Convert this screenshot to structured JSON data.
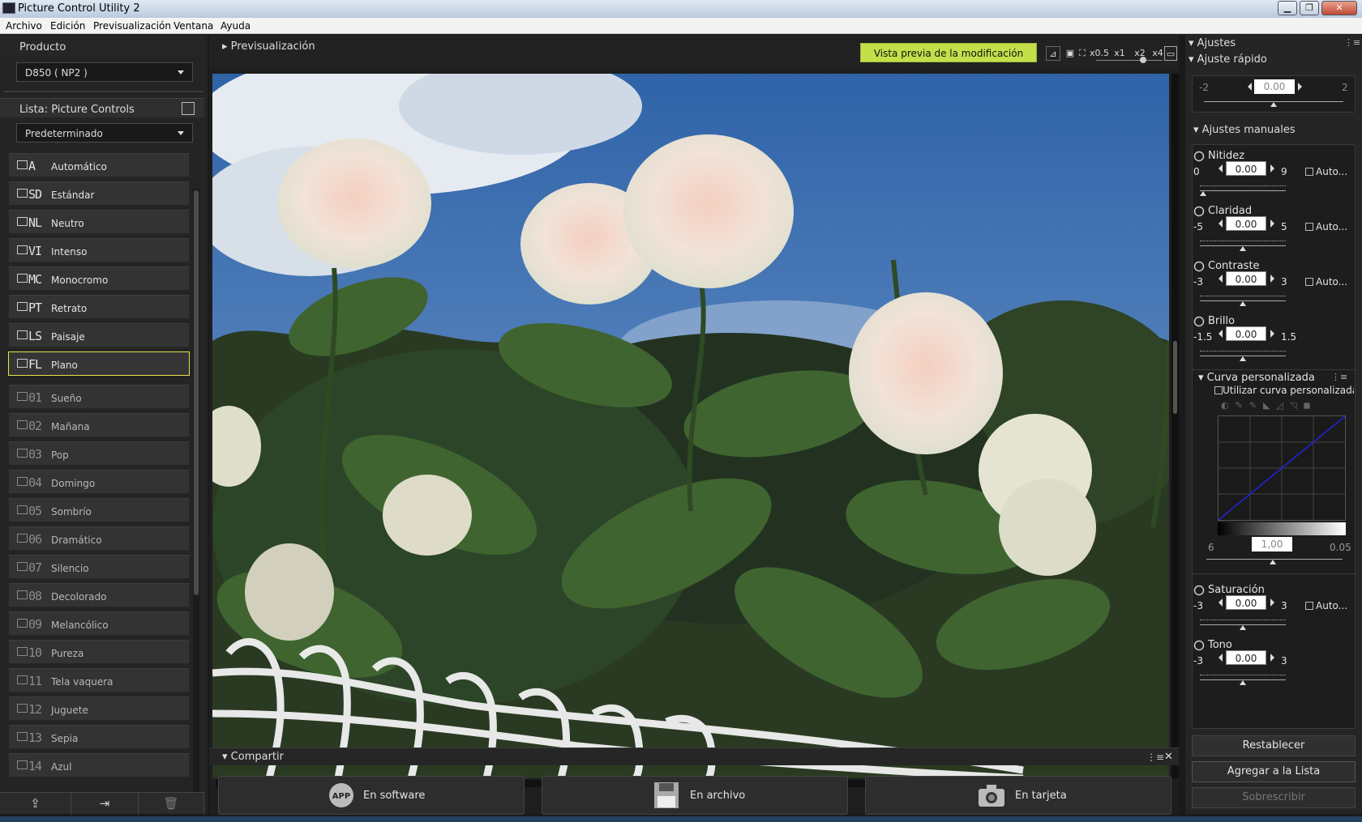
{
  "window": {
    "title": "Picture Control Utility 2",
    "minimize": "▁",
    "maximize": "❐",
    "close": "✕"
  },
  "menu": [
    "Archivo",
    "Edición",
    "Previsualización",
    "Ventana",
    "Ayuda"
  ],
  "left": {
    "product_header": "Producto",
    "product_value": "D850 ( NP2 )",
    "list_header": "Lista: Picture Controls",
    "list_filter": "Predeterminado",
    "presets": [
      {
        "code": "A",
        "name": "Automático"
      },
      {
        "code": "SD",
        "name": "Estándar"
      },
      {
        "code": "NL",
        "name": "Neutro"
      },
      {
        "code": "VI",
        "name": "Intenso"
      },
      {
        "code": "MC",
        "name": "Monocromo"
      },
      {
        "code": "PT",
        "name": "Retrato"
      },
      {
        "code": "LS",
        "name": "Paisaje"
      },
      {
        "code": "FL",
        "name": "Plano"
      }
    ],
    "selected_preset": "Plano",
    "creative": [
      {
        "code": "01",
        "name": "Sueño"
      },
      {
        "code": "02",
        "name": "Mañana"
      },
      {
        "code": "03",
        "name": "Pop"
      },
      {
        "code": "04",
        "name": "Domingo"
      },
      {
        "code": "05",
        "name": "Sombrío"
      },
      {
        "code": "06",
        "name": "Dramático"
      },
      {
        "code": "07",
        "name": "Silencio"
      },
      {
        "code": "08",
        "name": "Decolorado"
      },
      {
        "code": "09",
        "name": "Melancólico"
      },
      {
        "code": "10",
        "name": "Pureza"
      },
      {
        "code": "11",
        "name": "Tela vaquera"
      },
      {
        "code": "12",
        "name": "Juguete"
      },
      {
        "code": "13",
        "name": "Sepia"
      },
      {
        "code": "14",
        "name": "Azul"
      }
    ]
  },
  "preview": {
    "title": "Previsualización",
    "preview_button": "Vista previa de la modificación",
    "zoom": [
      "x0.5",
      "x1",
      "x2",
      "x4"
    ]
  },
  "share": {
    "title": "Compartir",
    "buttons": [
      {
        "label": "En software"
      },
      {
        "label": "En archivo"
      },
      {
        "label": "En tarjeta"
      }
    ]
  },
  "right": {
    "ajustes": "Ajustes",
    "ajuste_rapido": "Ajuste rápido",
    "quick": {
      "min": "-2",
      "max": "2",
      "value": "0.00"
    },
    "manual": "Ajustes manuales",
    "auto_label": "Auto...",
    "params": [
      {
        "name": "Nitidez",
        "min": "0",
        "max": "9",
        "value": "0.00",
        "auto": true
      },
      {
        "name": "Claridad",
        "min": "-5",
        "max": "5",
        "value": "0.00",
        "auto": true
      },
      {
        "name": "Contraste",
        "min": "-3",
        "max": "3",
        "value": "0.00",
        "auto": true
      },
      {
        "name": "Brillo",
        "min": "-1.5",
        "max": "1.5",
        "value": "0.00",
        "auto": false
      }
    ],
    "curve": {
      "title": "Curva personalizada",
      "use_label": "Utilizar curva personalizada",
      "gamma_min": "6",
      "gamma_value": "1,00",
      "gamma_max": "0.05"
    },
    "params2": [
      {
        "name": "Saturación",
        "min": "-3",
        "max": "3",
        "value": "0.00",
        "auto": true
      },
      {
        "name": "Tono",
        "min": "-3",
        "max": "3",
        "value": "0.00",
        "auto": false
      }
    ],
    "reset": "Restablecer",
    "add_to_list": "Agregar a la Lista",
    "overwrite": "Sobrescribir"
  }
}
